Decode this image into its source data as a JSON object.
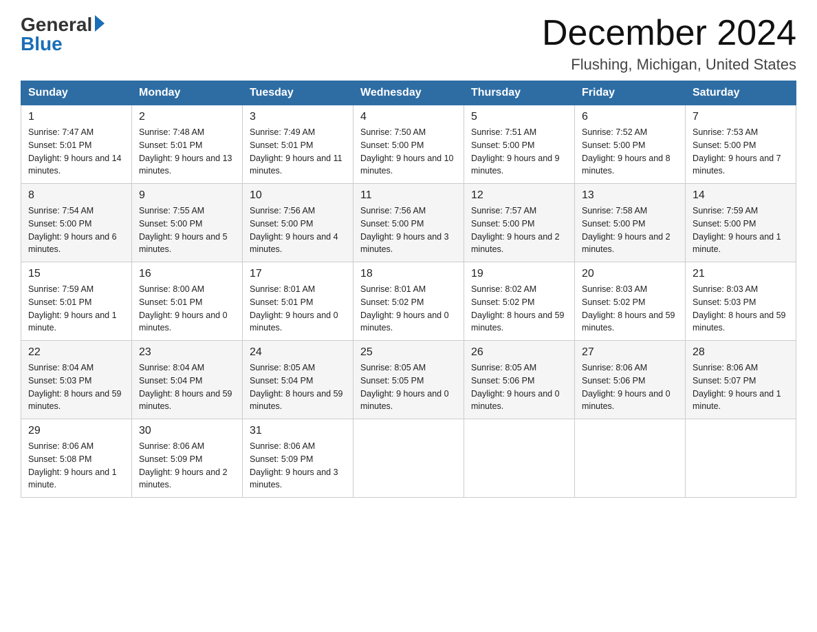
{
  "header": {
    "logo_general": "General",
    "logo_blue": "Blue",
    "month_title": "December 2024",
    "location": "Flushing, Michigan, United States"
  },
  "days_of_week": [
    "Sunday",
    "Monday",
    "Tuesday",
    "Wednesday",
    "Thursday",
    "Friday",
    "Saturday"
  ],
  "weeks": [
    [
      {
        "day": "1",
        "sunrise": "7:47 AM",
        "sunset": "5:01 PM",
        "daylight": "9 hours and 14 minutes."
      },
      {
        "day": "2",
        "sunrise": "7:48 AM",
        "sunset": "5:01 PM",
        "daylight": "9 hours and 13 minutes."
      },
      {
        "day": "3",
        "sunrise": "7:49 AM",
        "sunset": "5:01 PM",
        "daylight": "9 hours and 11 minutes."
      },
      {
        "day": "4",
        "sunrise": "7:50 AM",
        "sunset": "5:00 PM",
        "daylight": "9 hours and 10 minutes."
      },
      {
        "day": "5",
        "sunrise": "7:51 AM",
        "sunset": "5:00 PM",
        "daylight": "9 hours and 9 minutes."
      },
      {
        "day": "6",
        "sunrise": "7:52 AM",
        "sunset": "5:00 PM",
        "daylight": "9 hours and 8 minutes."
      },
      {
        "day": "7",
        "sunrise": "7:53 AM",
        "sunset": "5:00 PM",
        "daylight": "9 hours and 7 minutes."
      }
    ],
    [
      {
        "day": "8",
        "sunrise": "7:54 AM",
        "sunset": "5:00 PM",
        "daylight": "9 hours and 6 minutes."
      },
      {
        "day": "9",
        "sunrise": "7:55 AM",
        "sunset": "5:00 PM",
        "daylight": "9 hours and 5 minutes."
      },
      {
        "day": "10",
        "sunrise": "7:56 AM",
        "sunset": "5:00 PM",
        "daylight": "9 hours and 4 minutes."
      },
      {
        "day": "11",
        "sunrise": "7:56 AM",
        "sunset": "5:00 PM",
        "daylight": "9 hours and 3 minutes."
      },
      {
        "day": "12",
        "sunrise": "7:57 AM",
        "sunset": "5:00 PM",
        "daylight": "9 hours and 2 minutes."
      },
      {
        "day": "13",
        "sunrise": "7:58 AM",
        "sunset": "5:00 PM",
        "daylight": "9 hours and 2 minutes."
      },
      {
        "day": "14",
        "sunrise": "7:59 AM",
        "sunset": "5:00 PM",
        "daylight": "9 hours and 1 minute."
      }
    ],
    [
      {
        "day": "15",
        "sunrise": "7:59 AM",
        "sunset": "5:01 PM",
        "daylight": "9 hours and 1 minute."
      },
      {
        "day": "16",
        "sunrise": "8:00 AM",
        "sunset": "5:01 PM",
        "daylight": "9 hours and 0 minutes."
      },
      {
        "day": "17",
        "sunrise": "8:01 AM",
        "sunset": "5:01 PM",
        "daylight": "9 hours and 0 minutes."
      },
      {
        "day": "18",
        "sunrise": "8:01 AM",
        "sunset": "5:02 PM",
        "daylight": "9 hours and 0 minutes."
      },
      {
        "day": "19",
        "sunrise": "8:02 AM",
        "sunset": "5:02 PM",
        "daylight": "8 hours and 59 minutes."
      },
      {
        "day": "20",
        "sunrise": "8:03 AM",
        "sunset": "5:02 PM",
        "daylight": "8 hours and 59 minutes."
      },
      {
        "day": "21",
        "sunrise": "8:03 AM",
        "sunset": "5:03 PM",
        "daylight": "8 hours and 59 minutes."
      }
    ],
    [
      {
        "day": "22",
        "sunrise": "8:04 AM",
        "sunset": "5:03 PM",
        "daylight": "8 hours and 59 minutes."
      },
      {
        "day": "23",
        "sunrise": "8:04 AM",
        "sunset": "5:04 PM",
        "daylight": "8 hours and 59 minutes."
      },
      {
        "day": "24",
        "sunrise": "8:05 AM",
        "sunset": "5:04 PM",
        "daylight": "8 hours and 59 minutes."
      },
      {
        "day": "25",
        "sunrise": "8:05 AM",
        "sunset": "5:05 PM",
        "daylight": "9 hours and 0 minutes."
      },
      {
        "day": "26",
        "sunrise": "8:05 AM",
        "sunset": "5:06 PM",
        "daylight": "9 hours and 0 minutes."
      },
      {
        "day": "27",
        "sunrise": "8:06 AM",
        "sunset": "5:06 PM",
        "daylight": "9 hours and 0 minutes."
      },
      {
        "day": "28",
        "sunrise": "8:06 AM",
        "sunset": "5:07 PM",
        "daylight": "9 hours and 1 minute."
      }
    ],
    [
      {
        "day": "29",
        "sunrise": "8:06 AM",
        "sunset": "5:08 PM",
        "daylight": "9 hours and 1 minute."
      },
      {
        "day": "30",
        "sunrise": "8:06 AM",
        "sunset": "5:09 PM",
        "daylight": "9 hours and 2 minutes."
      },
      {
        "day": "31",
        "sunrise": "8:06 AM",
        "sunset": "5:09 PM",
        "daylight": "9 hours and 3 minutes."
      },
      null,
      null,
      null,
      null
    ]
  ]
}
